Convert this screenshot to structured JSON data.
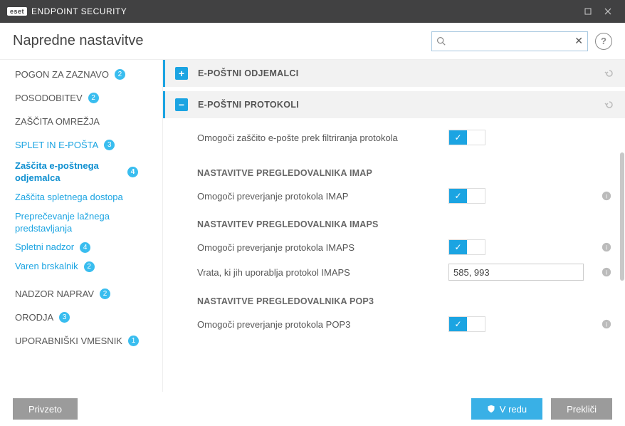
{
  "titlebar": {
    "brand_badge": "eset",
    "brand_text": "ENDPOINT SECURITY"
  },
  "subheader": {
    "title": "Napredne nastavitve",
    "search_placeholder": ""
  },
  "sidebar": {
    "items": [
      {
        "label": "POGON ZA ZAZNAVO",
        "badge": "2"
      },
      {
        "label": "POSODOBITEV",
        "badge": "2"
      },
      {
        "label": "ZAŠČITA OMREŽJA",
        "badge": ""
      },
      {
        "label": "SPLET IN E-POŠTA",
        "badge": "3"
      }
    ],
    "sub": [
      {
        "label": "Zaščita e-poštnega odjemalca",
        "badge": "4"
      },
      {
        "label": "Zaščita spletnega dostopa",
        "badge": ""
      },
      {
        "label": "Preprečevanje lažnega predstavljanja",
        "badge": ""
      },
      {
        "label": "Spletni nadzor",
        "badge": "4"
      },
      {
        "label": "Varen brskalnik",
        "badge": "2"
      }
    ],
    "items2": [
      {
        "label": "NADZOR NAPRAV",
        "badge": "2"
      },
      {
        "label": "ORODJA",
        "badge": "3"
      },
      {
        "label": "UPORABNIŠKI VMESNIK",
        "badge": "1"
      }
    ]
  },
  "content": {
    "section_clients": {
      "title": "E-POŠTNI ODJEMALCI",
      "expand": "+"
    },
    "section_protocols": {
      "title": "E-POŠTNI PROTOKOLI",
      "expand": "−"
    },
    "row_enable_filter": {
      "label": "Omogoči zaščito e-pošte prek filtriranja protokola"
    },
    "group_imap": {
      "title": "NASTAVITVE PREGLEDOVALNIKA IMAP"
    },
    "row_imap": {
      "label": "Omogoči preverjanje protokola IMAP"
    },
    "group_imaps": {
      "title": "NASTAVITEV PREGLEDOVALNIKA IMAPS"
    },
    "row_imaps": {
      "label": "Omogoči preverjanje protokola IMAPS"
    },
    "row_imaps_ports": {
      "label": "Vrata, ki jih uporablja protokol IMAPS",
      "value": "585, 993"
    },
    "group_pop3": {
      "title": "NASTAVITVE PREGLEDOVALNIKA POP3"
    },
    "row_pop3": {
      "label": "Omogoči preverjanje protokola POP3"
    }
  },
  "footer": {
    "default": "Privzeto",
    "ok": "V redu",
    "cancel": "Prekliči"
  }
}
